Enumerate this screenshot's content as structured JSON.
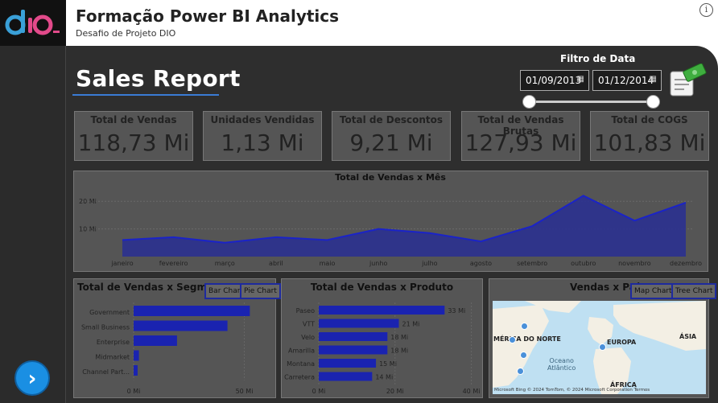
{
  "app": {
    "logo_text": "dio.",
    "title": "Formação Power BI Analytics",
    "subtitle": "Desafio de Projeto DIO",
    "info_icon": "i"
  },
  "report": {
    "title": "Sales Report"
  },
  "filter": {
    "title": "Filtro de Data",
    "start_date": "01/09/2013",
    "end_date": "01/12/2014",
    "calendar_glyph": "▦"
  },
  "kpis": [
    {
      "label": "Total de Vendas",
      "value": "118,73 Mi"
    },
    {
      "label": "Unidades Vendidas",
      "value": "1,13 Mi"
    },
    {
      "label": "Total de Descontos",
      "value": "9,21 Mi"
    },
    {
      "label": "Total de Vendas Brutas",
      "value": "127,93 Mi"
    },
    {
      "label": "Total de COGS",
      "value": "101,83 Mi"
    }
  ],
  "buttons": {
    "bar_chart": "Bar Chart",
    "pie_chart": "Pie Chart",
    "map_chart": "Map Chart",
    "tree_chart": "Tree Chart",
    "nav": "›"
  },
  "map": {
    "title": "Vendas x País",
    "labels": {
      "north_america": "MÉRICA DO NORTE",
      "europe": "EUROPA",
      "asia": "ÁSIA",
      "africa": "ÁFRICA",
      "ocean": "Oceano\nAtlântico"
    },
    "attribution": "Microsoft Bing   © 2024 TomTom, © 2024 Microsoft Corporation  Termos"
  },
  "colors": {
    "accent": "#1e2a9e",
    "area_fill": "#2b3190",
    "bar": "#1a23b0",
    "canvas": "#2e2e2e",
    "panel": "#555555"
  },
  "chart_data": [
    {
      "type": "area",
      "title": "Total de Vendas x Mês",
      "categories": [
        "janeiro",
        "fevereiro",
        "março",
        "abril",
        "maio",
        "junho",
        "julho",
        "agosto",
        "setembro",
        "outubro",
        "novembro",
        "dezembro"
      ],
      "series": [
        {
          "values": [
            6.0,
            7.0,
            5.0,
            7.0,
            6.0,
            10.0,
            8.5,
            5.5,
            11.0,
            22.0,
            13.0,
            19.5
          ]
        }
      ],
      "y_ticks": [
        "10 Mi",
        "20 Mi"
      ],
      "y_tick_values": [
        10,
        20
      ],
      "ylim": [
        0,
        25
      ],
      "grid": true
    },
    {
      "type": "bar",
      "orientation": "horizontal",
      "title": "Total de Vendas x Segmento",
      "categories": [
        "Government",
        "Small Business",
        "Enterprise",
        "Midmarket",
        "Channel Part..."
      ],
      "values": [
        52.5,
        42.4,
        19.6,
        2.4,
        1.8
      ],
      "x_ticks": [
        "0 Mi",
        "50 Mi"
      ],
      "x_tick_values": [
        0,
        50
      ],
      "xlim": [
        0,
        60
      ]
    },
    {
      "type": "bar",
      "orientation": "horizontal",
      "title": "Total de Vendas x Produto",
      "categories": [
        "Paseo",
        "VTT",
        "Velo",
        "Amarilla",
        "Montana",
        "Carretera"
      ],
      "values": [
        33,
        21,
        18,
        18,
        15,
        14
      ],
      "data_labels": [
        "33 Mi",
        "21 Mi",
        "18 Mi",
        "18 Mi",
        "15 Mi",
        "14 Mi"
      ],
      "x_ticks": [
        "0 Mi",
        "20 Mi",
        "40 Mi"
      ],
      "x_tick_values": [
        0,
        20,
        40
      ],
      "xlim": [
        0,
        42
      ]
    }
  ]
}
